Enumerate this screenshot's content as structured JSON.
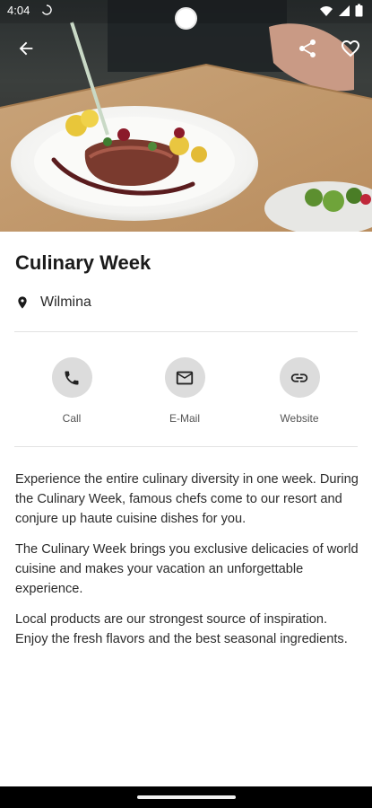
{
  "status_bar": {
    "time": "4:04"
  },
  "header": {
    "back_icon": "arrow-left-icon",
    "share_icon": "share-icon",
    "favorite_icon": "heart-outline-icon"
  },
  "event": {
    "title": "Culinary Week",
    "location": "Wilmina"
  },
  "actions": [
    {
      "label": "Call",
      "icon": "phone-icon"
    },
    {
      "label": "E-Mail",
      "icon": "mail-icon"
    },
    {
      "label": "Website",
      "icon": "link-icon"
    }
  ],
  "description": [
    "Experience the entire culinary diversity in one week. During the Culinary Week, famous chefs come to our resort and conjure up haute cuisine dishes for you.",
    "The Culinary Week brings you exclusive delicacies of world cuisine and makes your vacation an unforgettable experience.",
    "Local products are our strongest source of inspiration. Enjoy the fresh flavors and the best seasonal ingredients."
  ],
  "colors": {
    "action_circle": "#dcdcdc",
    "text_primary": "#1b1b1b"
  }
}
